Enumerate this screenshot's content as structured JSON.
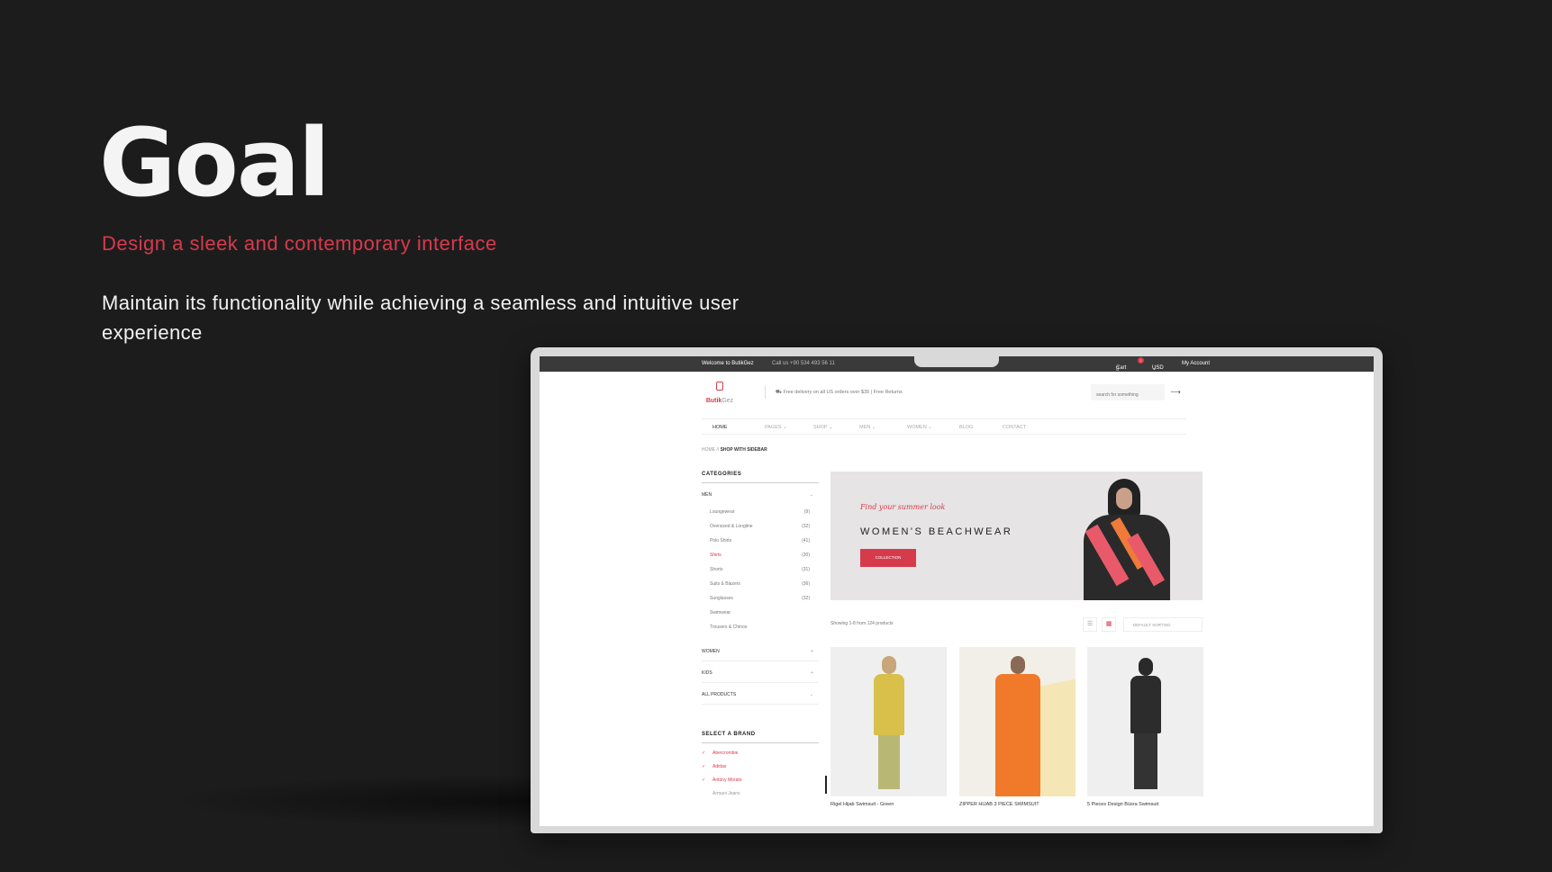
{
  "slide": {
    "title": "Goal",
    "subtitle": "Design a sleek and contemporary interface",
    "description": "Maintain its functionality while achieving a seamless and intuitive user experience"
  },
  "site": {
    "topbar": {
      "welcome": "Welcome to ButikGez",
      "phone": "Call us +90 534 493 56 11",
      "cart_label": "Cart",
      "cart_count": "2",
      "currency": "USD",
      "currency_caret": "⌄",
      "account": "My Account"
    },
    "header": {
      "logo_main": "Butik",
      "logo_sub": "Gez",
      "delivery": "Free delivery on all US orders over $35 | Free Returns",
      "search_placeholder": "search for something",
      "search_arrow": "⟶"
    },
    "nav": {
      "items": [
        "HOME",
        "PAGES ⌄",
        "SHOP ⌄",
        "MEN ⌄",
        "WOMEN ⌄",
        "BLOG",
        "CONTACT"
      ]
    },
    "breadcrumb": {
      "home": "HOME",
      "sep": "//",
      "current": "SHOP WITH SIDEBAR"
    },
    "sidebar": {
      "categories_title": "CATEGORIES",
      "men_label": "MEN",
      "men_chevron": "⌄",
      "men_items": [
        {
          "label": "Loungewear",
          "count": "(9)"
        },
        {
          "label": "Oversized & Longline",
          "count": "(32)"
        },
        {
          "label": "Polo Shirts",
          "count": "(41)"
        },
        {
          "label": "Shirts",
          "count": "(30)"
        },
        {
          "label": "Shorts",
          "count": "(31)"
        },
        {
          "label": "Suits & Blazers",
          "count": "(36)"
        },
        {
          "label": "Sunglasses",
          "count": "(32)"
        },
        {
          "label": "Swimwear",
          "count": ""
        },
        {
          "label": "Trousers & Chinos",
          "count": ""
        }
      ],
      "other_categories": [
        {
          "label": "WOMEN",
          "chevron": "+"
        },
        {
          "label": "KIDS",
          "chevron": "+"
        },
        {
          "label": "ALL PRODUCTS",
          "chevron": "⌄"
        }
      ],
      "brand_title": "SELECT A BRAND",
      "check_mark": "✓",
      "brands": [
        "Abercrombie",
        "Adidas",
        "Antony Morato",
        "Armani Jeans"
      ]
    },
    "banner": {
      "tagline": "Find your summer look",
      "title": "WOMEN'S BEACHWEAR",
      "button": "COLLECTION"
    },
    "toolbar": {
      "showing": "Showing 1-8 from 124 products",
      "list_icon": "☰",
      "grid_icon": "▦",
      "sort": "DEFAULT SORTING"
    },
    "products": [
      {
        "name": "Rigel Hijab Swimsuit - Green"
      },
      {
        "name": "ZIPPER HIJAB 3 PIECE SWIMSUIT"
      },
      {
        "name": "5 Pieces Design Büsra Swimsuit"
      }
    ]
  },
  "colors": {
    "accent": "#d63b4c",
    "background": "#1d1c1d",
    "topbar": "#3a3a3a"
  }
}
